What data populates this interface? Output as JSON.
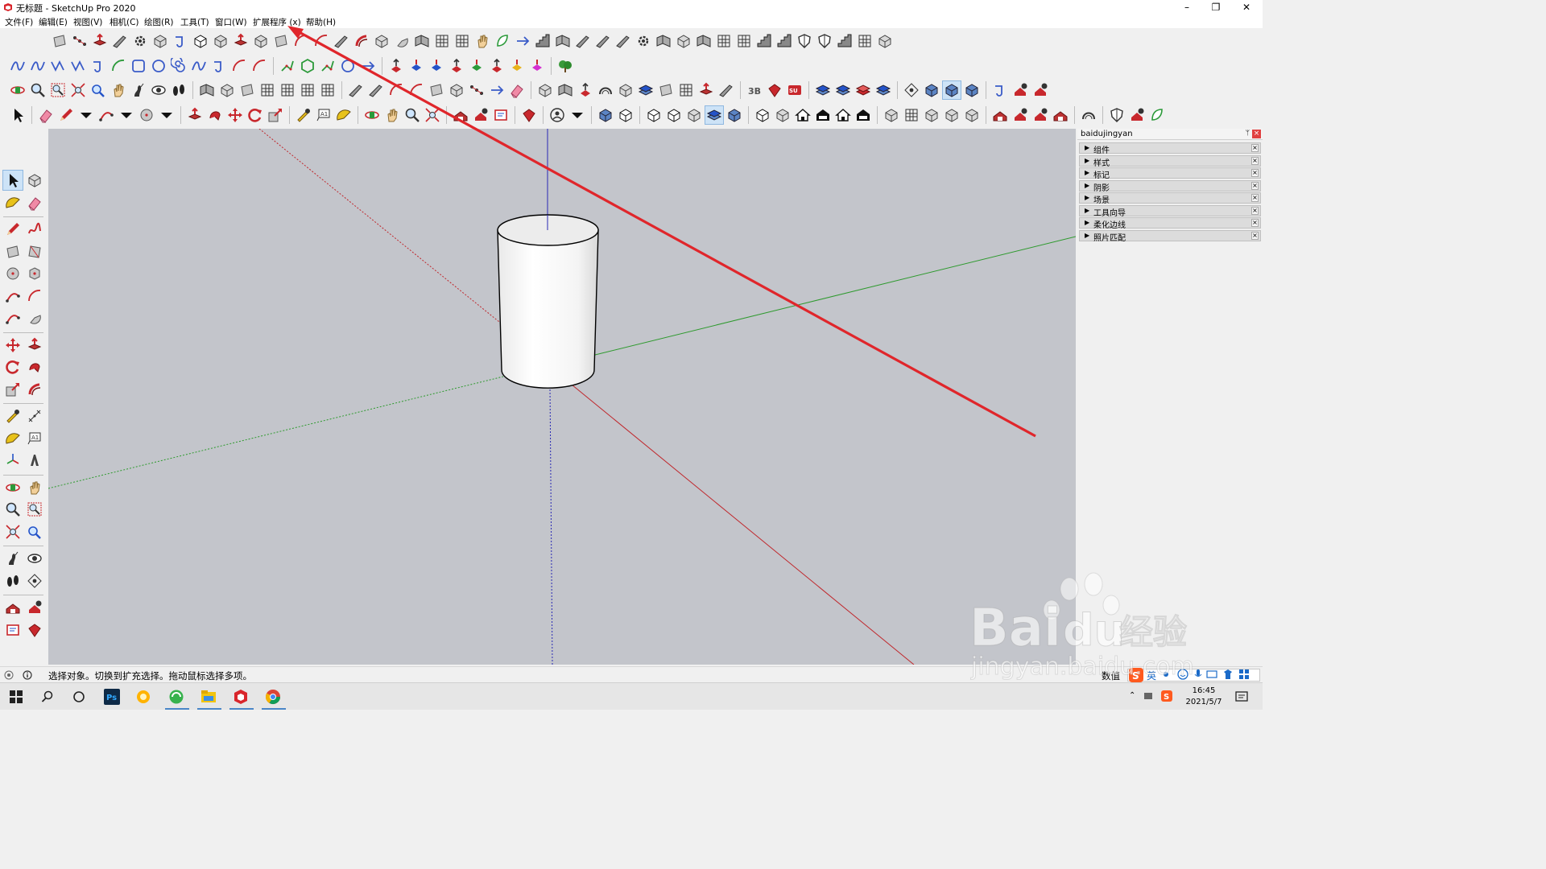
{
  "window": {
    "title": "无标题 - SketchUp Pro 2020",
    "minimize": "–",
    "restore": "❐",
    "close": "✕"
  },
  "menu": [
    {
      "label": "文件(F)"
    },
    {
      "label": "编辑(E)"
    },
    {
      "label": "视图(V)"
    },
    {
      "label": "相机(C)"
    },
    {
      "label": "绘图(R)"
    },
    {
      "label": "工具(T)"
    },
    {
      "label": "窗口(W)"
    },
    {
      "label": "扩展程序 (x)"
    },
    {
      "label": "帮助(H)"
    }
  ],
  "tray": {
    "title": "baidujingyan",
    "pin": "ᛘ",
    "close": "×",
    "panels": [
      {
        "label": "组件"
      },
      {
        "label": "样式"
      },
      {
        "label": "标记"
      },
      {
        "label": "阴影"
      },
      {
        "label": "场景"
      },
      {
        "label": "工具向导"
      },
      {
        "label": "柔化边线"
      },
      {
        "label": "照片匹配"
      }
    ],
    "panel_close": "×"
  },
  "status": {
    "message": "选择对象。切换到扩充选择。拖动鼠标选择多项。",
    "value_label": "数值"
  },
  "taskbar": {
    "time": "16:45",
    "date": "2021/5/7",
    "ime": "英"
  },
  "watermark": {
    "brand_a": "Bai",
    "brand_b": "du",
    "brand_cn": "经验",
    "url": "jingyan.baidu.com"
  },
  "colors": {
    "viewport_bg": "#c3c5cb",
    "axis_red": "#c0282d",
    "axis_green": "#2e9a2e",
    "axis_blue": "#2828b4",
    "annotation_red": "#e0262b"
  }
}
